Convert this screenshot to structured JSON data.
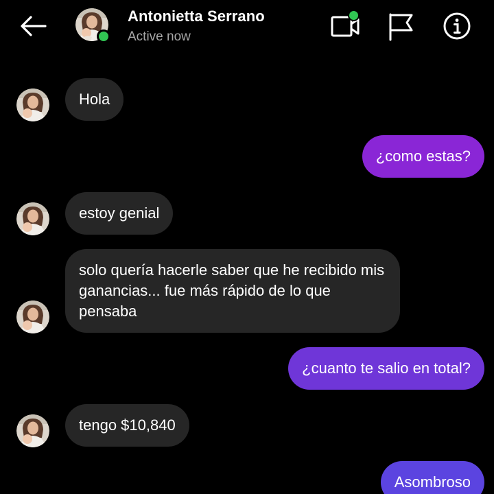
{
  "header": {
    "contact_name": "Antonietta Serrano",
    "status": "Active now",
    "back_icon": "arrow-left-icon",
    "video_icon": "video-call-icon",
    "flag_icon": "flag-icon",
    "info_icon": "info-icon",
    "presence_color": "#31c553"
  },
  "messages": [
    {
      "sender": "contact",
      "text": "Hola"
    },
    {
      "sender": "me",
      "text": "¿como estas?"
    },
    {
      "sender": "contact",
      "text": "estoy genial"
    },
    {
      "sender": "contact",
      "text": "solo quería hacerle saber que he recibido mis ganancias... fue más rápido de lo que pensaba"
    },
    {
      "sender": "me",
      "text": "¿cuanto te salio en total?"
    },
    {
      "sender": "contact",
      "text": "tengo $10,840"
    },
    {
      "sender": "me",
      "text": "Asombroso"
    }
  ],
  "colors": {
    "background": "#000000",
    "incoming_bubble": "#262626",
    "outgoing_bubble_1": "#8a26d6",
    "outgoing_bubble_2": "#6f36d8",
    "outgoing_bubble_3": "#5b44e0",
    "secondary_text": "#a8a8a8"
  }
}
